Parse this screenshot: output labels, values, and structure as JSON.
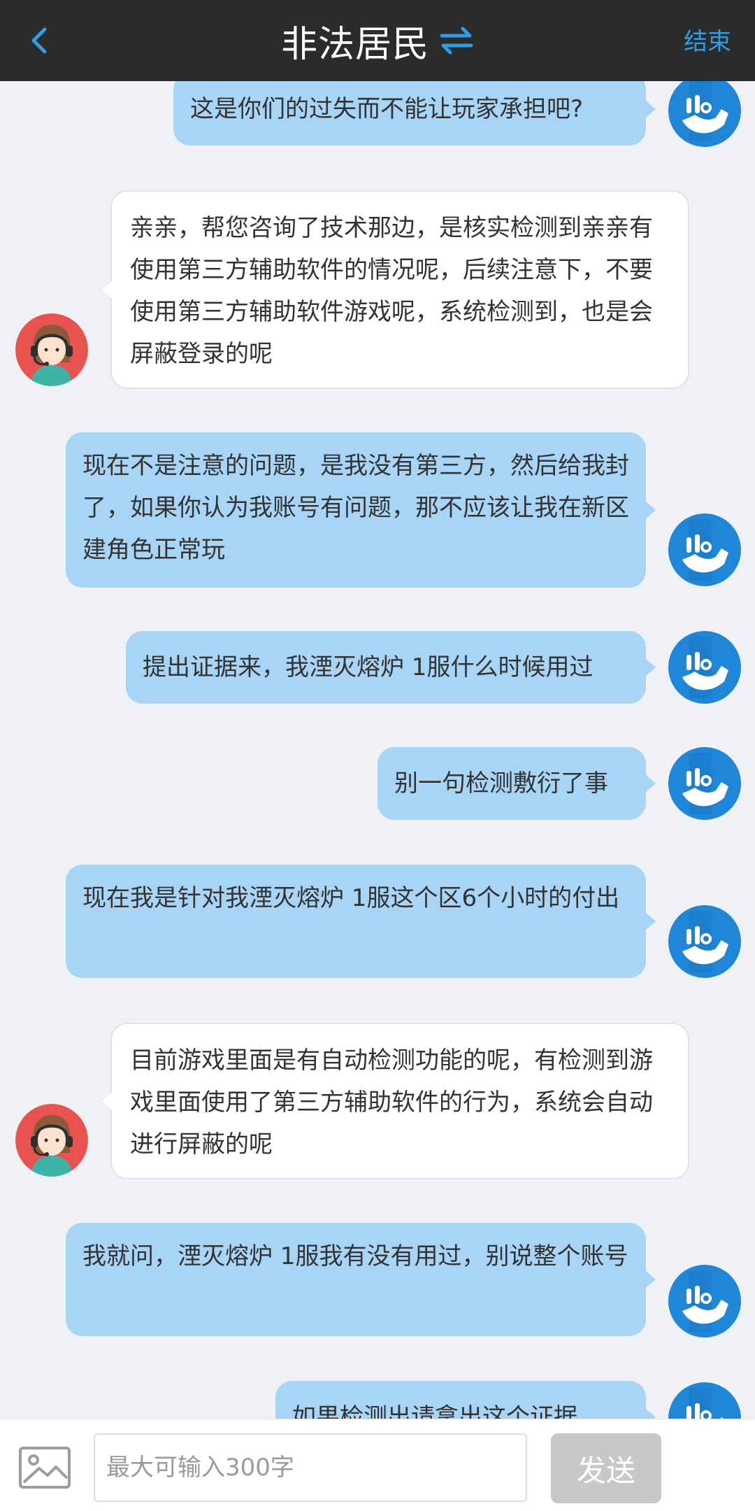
{
  "header": {
    "title": "非法居民",
    "end_label": "结束",
    "back_icon": "chevron-left-icon",
    "swap_icon": "swap-arrows-icon"
  },
  "colors": {
    "accent": "#2f9ce6",
    "user_bubble": "#a8d4f6",
    "header_bg": "#2b2b2b",
    "avatar_blue": "#1f86d8"
  },
  "messages": [
    {
      "sender": "user",
      "text": "这是你们的过失而不能让玩家承担吧?"
    },
    {
      "sender": "agent",
      "text": "亲亲，帮您咨询了技术那边，是核实检测到亲亲有使用第三方辅助软件的情况呢，后续注意下，不要使用第三方辅助软件游戏呢，系统检测到，也是会屏蔽登录的呢"
    },
    {
      "sender": "user",
      "text": "现在不是注意的问题，是我没有第三方，然后给我封了，如果你认为我账号有问题，那不应该让我在新区建角色正常玩"
    },
    {
      "sender": "user",
      "text": "提出证据来，我湮灭熔炉 1服什么时候用过"
    },
    {
      "sender": "user",
      "text": "别一句检测敷衍了事"
    },
    {
      "sender": "user",
      "text": "现在我是针对我湮灭熔炉 1服这个区6个小时的付出"
    },
    {
      "sender": "agent",
      "text": "目前游戏里面是有自动检测功能的呢，有检测到游戏里面使用了第三方辅助软件的行为，系统会自动进行屏蔽的呢"
    },
    {
      "sender": "user",
      "text": "我就问，湮灭熔炉 1服我有没有用过，别说整个账号"
    },
    {
      "sender": "user",
      "text": "如果检测出请拿出这个证据"
    }
  ],
  "input": {
    "placeholder": "最大可输入300字",
    "send_label": "发送",
    "image_icon": "image-icon"
  }
}
